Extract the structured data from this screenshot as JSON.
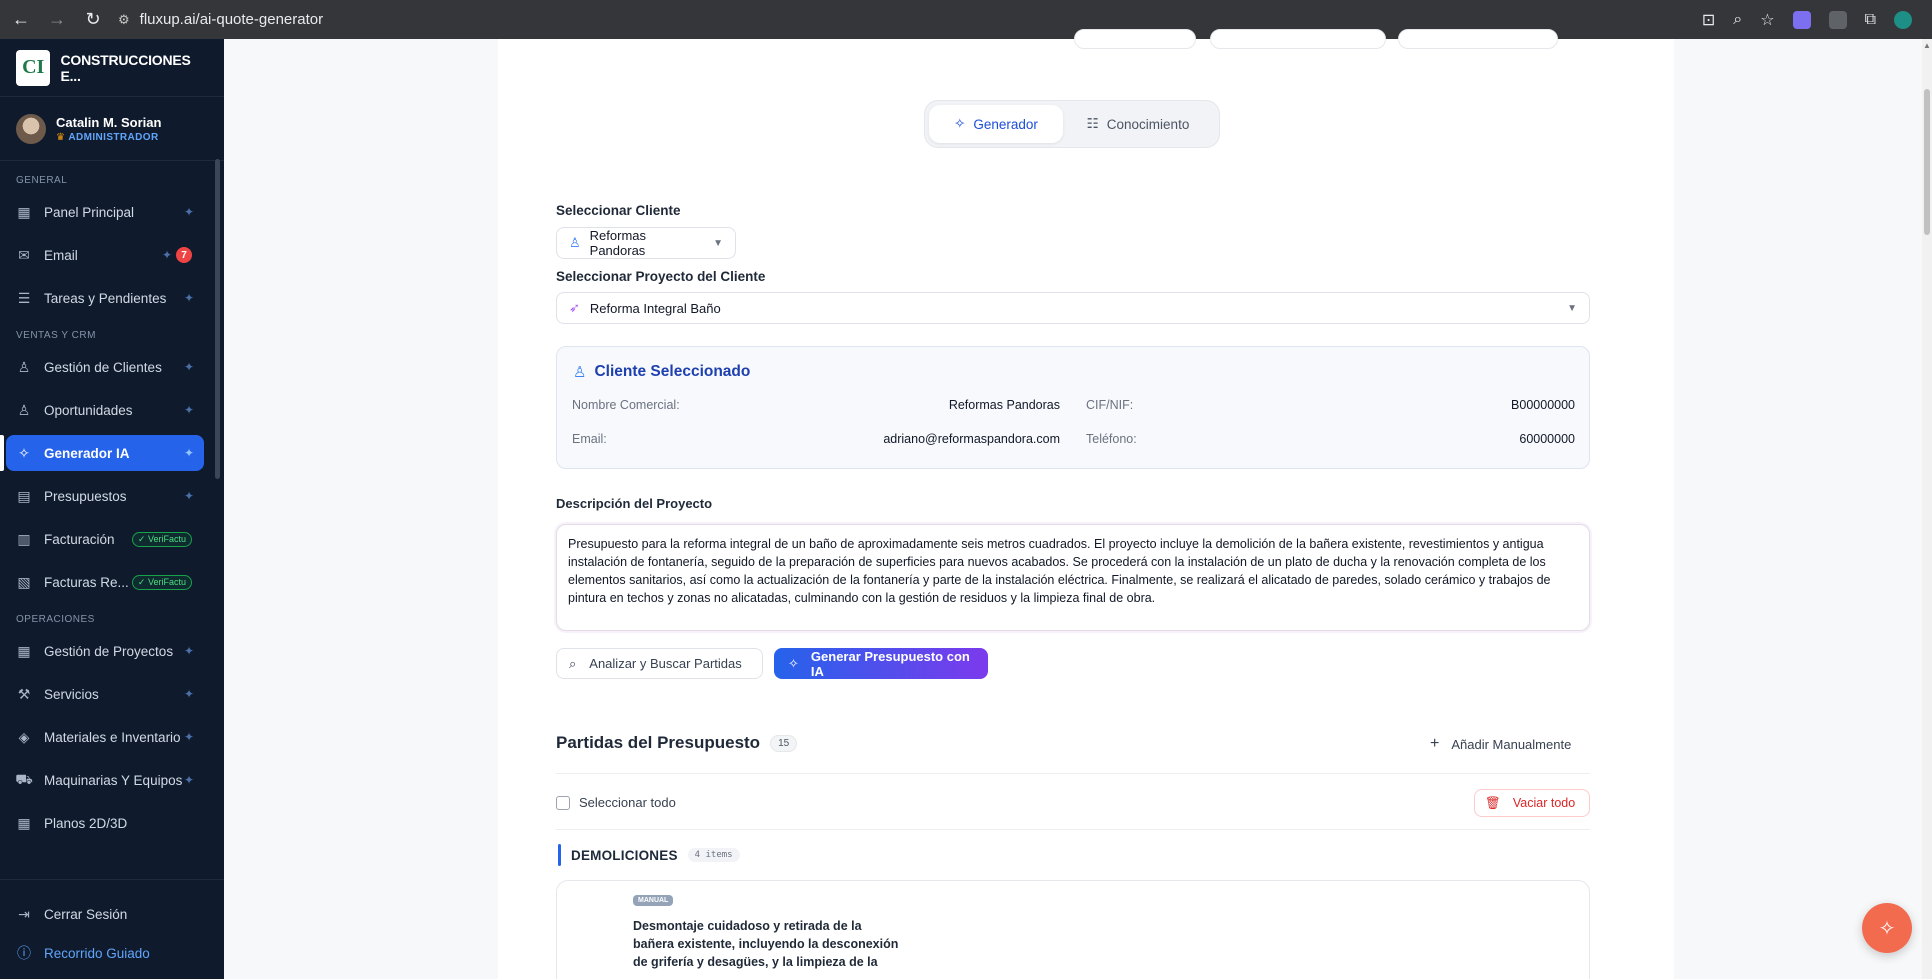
{
  "browser": {
    "url": "fluxup.ai/ai-quote-generator"
  },
  "sidebar": {
    "brand_name": "CONSTRUCCIONES E...",
    "logo_letters": "CI",
    "user_name": "Catalin M. Sorian",
    "user_role": "ADMINISTRADOR",
    "sections": {
      "general": "GENERAL",
      "ventas": "VENTAS Y CRM",
      "operaciones": "OPERACIONES"
    },
    "items": {
      "panel": "Panel Principal",
      "email": "Email",
      "email_count": "7",
      "tareas": "Tareas y Pendientes",
      "clientes": "Gestión de Clientes",
      "oportunidades": "Oportunidades",
      "generador": "Generador IA",
      "presupuestos": "Presupuestos",
      "facturacion": "Facturación",
      "facturas_re": "Facturas Re...",
      "verifactu": "VeriFactu",
      "proyectos": "Gestión de Proyectos",
      "servicios": "Servicios",
      "materiales": "Materiales e Inventario",
      "maquinarias": "Maquinarias Y Equipos",
      "planos": "Planos 2D/3D"
    },
    "logout": "Cerrar Sesión",
    "tour": "Recorrido Guiado"
  },
  "tabs": {
    "generador": "Generador",
    "conocimiento": "Conocimiento"
  },
  "form": {
    "client_label": "Seleccionar Cliente",
    "client_value": "Reformas Pandoras",
    "project_label": "Seleccionar Proyecto del Cliente",
    "project_value": "Reforma Integral Baño"
  },
  "client_card": {
    "title": "Cliente Seleccionado",
    "nombre_label": "Nombre Comercial:",
    "nombre_value": "Reformas Pandoras",
    "cif_label": "CIF/NIF:",
    "cif_value": "B00000000",
    "email_label": "Email:",
    "email_value": "adriano@reformaspandora.com",
    "telefono_label": "Teléfono:",
    "telefono_value": "60000000"
  },
  "description": {
    "label": "Descripción del Proyecto",
    "text": "Presupuesto para la reforma integral de un baño de aproximadamente seis metros cuadrados. El proyecto incluye la demolición de la bañera existente, revestimientos y antigua instalación de fontanería, seguido de la preparación de superficies para nuevos acabados. Se procederá con la instalación de un plato de ducha y la renovación completa de los elementos sanitarios, así como la actualización de la fontanería y parte de la instalación eléctrica. Finalmente, se realizará el alicatado de paredes, solado cerámico y trabajos de pintura en techos y zonas no alicatadas, culminando con la gestión de residuos y la limpieza final de obra."
  },
  "actions": {
    "analyze": "Analizar y Buscar Partidas",
    "generate": "Generar Presupuesto con IA"
  },
  "partidas": {
    "title": "Partidas del Presupuesto",
    "count": "15",
    "add_manual": "Añadir Manualmente",
    "select_all": "Seleccionar todo",
    "clear_all": "Vaciar todo",
    "group_name": "DEMOLICIONES",
    "group_items": "4 items",
    "item_tag": "MANUAL",
    "item_text": "Desmontaje cuidadoso y retirada de la bañera existente, incluyendo la desconexión de grifería y desagües, y la limpieza de la"
  },
  "icons": {
    "back": "arrow-left-icon",
    "forward": "arrow-right-icon",
    "reload": "reload-icon",
    "sparkle": "sparkle-icon",
    "database": "database-icon",
    "user": "user-icon",
    "rocket": "rocket-icon",
    "search": "search-icon",
    "plus": "plus-icon",
    "trash": "trash-icon"
  },
  "colors": {
    "sidebar_bg": "#0f1b2d",
    "accent": "#2563eb",
    "generate_gradient_end": "#7c3aed",
    "danger": "#dc2626",
    "fab": "#f26b4f"
  }
}
